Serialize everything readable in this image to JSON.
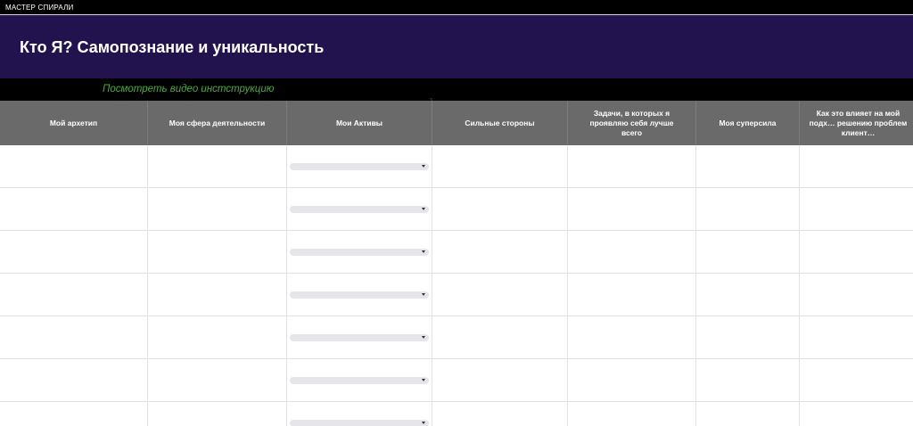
{
  "topbar": {
    "label": "МАСТЕР СПИРАЛИ"
  },
  "banner": {
    "title": "Кто Я? Самопознание и уникальность",
    "color": "#22134f"
  },
  "video": {
    "link_text": "Посмотреть видео инстструкцию",
    "color": "#4aa83e"
  },
  "table": {
    "header_color": "#6a6a6a",
    "columns": [
      "Мой архетип",
      "Моя сфера деятельности",
      "Мои Активы",
      "Сильные стороны",
      "Задачи, в которых я проявляю себя лучше всего",
      "Моя суперсила",
      "Как это влияет на мой подх… решению проблем клиент…"
    ],
    "dropdown_column": "Мои Активы",
    "row_count": 7
  }
}
